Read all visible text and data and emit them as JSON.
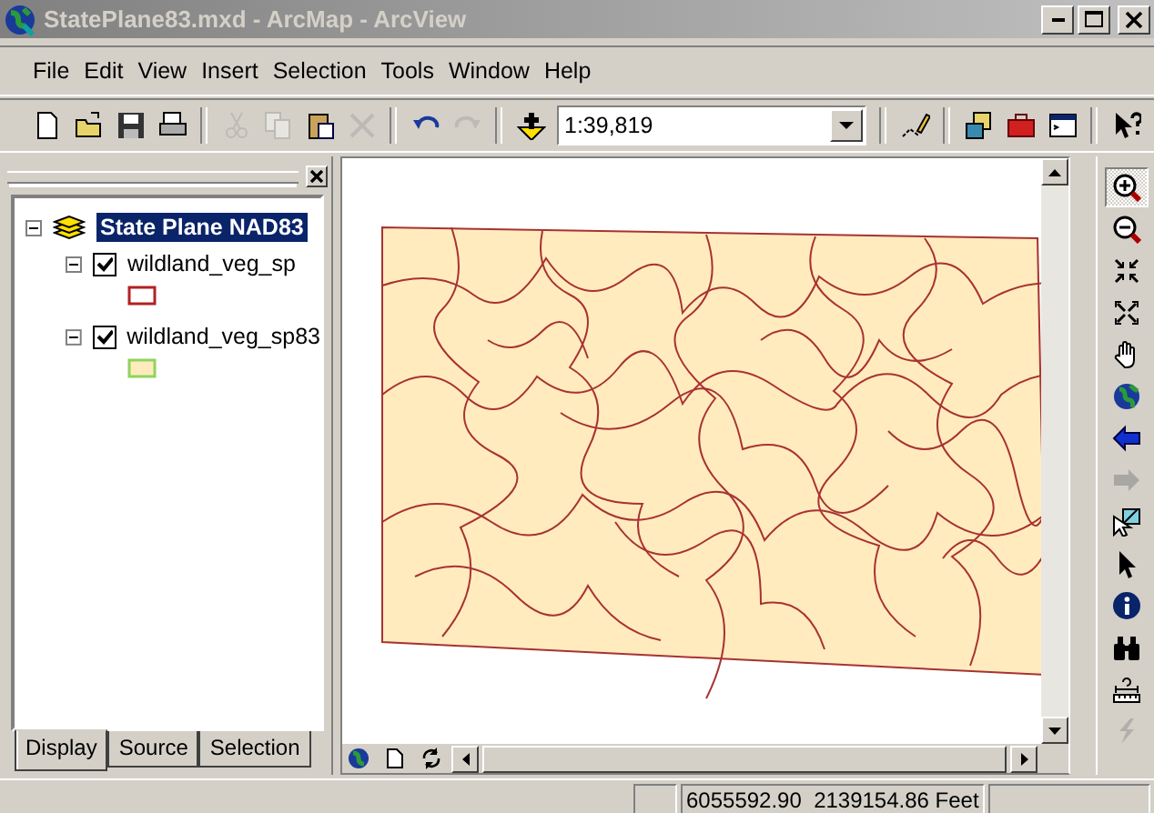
{
  "window": {
    "title": "StatePlane83.mxd - ArcMap - ArcView"
  },
  "menu": [
    {
      "label": "File"
    },
    {
      "label": "Edit"
    },
    {
      "label": "View"
    },
    {
      "label": "Insert"
    },
    {
      "label": "Selection"
    },
    {
      "label": "Tools"
    },
    {
      "label": "Window"
    },
    {
      "label": "Help"
    }
  ],
  "toolbar": [
    {
      "kind": "new",
      "disabled": false
    },
    {
      "kind": "open",
      "disabled": false
    },
    {
      "kind": "save",
      "disabled": false
    },
    {
      "kind": "print",
      "disabled": false
    },
    {
      "kind": "separator"
    },
    {
      "kind": "cut",
      "disabled": true
    },
    {
      "kind": "copy",
      "disabled": true
    },
    {
      "kind": "paste",
      "disabled": false
    },
    {
      "kind": "delete",
      "disabled": true
    },
    {
      "kind": "separator"
    },
    {
      "kind": "undo",
      "disabled": false
    },
    {
      "kind": "redo",
      "disabled": true
    },
    {
      "kind": "separator"
    },
    {
      "kind": "add-data",
      "disabled": false
    },
    {
      "kind": "scale",
      "value": "1:39,819"
    },
    {
      "kind": "separator"
    },
    {
      "kind": "editor",
      "disabled": false
    },
    {
      "kind": "separator"
    },
    {
      "kind": "catalog",
      "disabled": false
    },
    {
      "kind": "toolbox",
      "disabled": false
    },
    {
      "kind": "command",
      "disabled": false
    },
    {
      "kind": "separator"
    },
    {
      "kind": "help",
      "disabled": false
    }
  ],
  "toc": {
    "data_frame": {
      "label": "State Plane NAD83",
      "selected": true,
      "expanded": true
    },
    "layers": [
      {
        "name": "wildland_veg_sp",
        "checked": true,
        "expanded": true,
        "kind": "hollow",
        "color": "#b22222"
      },
      {
        "name": "wildland_veg_sp83",
        "checked": true,
        "expanded": true,
        "kind": "filled",
        "color": "#8fd45a"
      }
    ],
    "tabs": [
      {
        "label": "Display",
        "selected": true
      },
      {
        "label": "Source",
        "selected": false
      },
      {
        "label": "Selection",
        "selected": false
      }
    ]
  },
  "tools": [
    {
      "kind": "zoom-in",
      "selected": true,
      "disabled": false
    },
    {
      "kind": "zoom-out",
      "selected": false,
      "disabled": false
    },
    {
      "kind": "fixed-in",
      "selected": false,
      "disabled": false
    },
    {
      "kind": "fixed-out",
      "selected": false,
      "disabled": false
    },
    {
      "kind": "pan",
      "selected": false,
      "disabled": false
    },
    {
      "kind": "globe",
      "selected": false,
      "disabled": false
    },
    {
      "kind": "back",
      "selected": false,
      "disabled": false
    },
    {
      "kind": "forward",
      "selected": false,
      "disabled": true
    },
    {
      "kind": "select-features",
      "selected": false,
      "disabled": false
    },
    {
      "kind": "pointer",
      "selected": false,
      "disabled": false
    },
    {
      "kind": "identify",
      "selected": false,
      "disabled": false
    },
    {
      "kind": "find",
      "selected": false,
      "disabled": false
    },
    {
      "kind": "measure",
      "selected": false,
      "disabled": false
    },
    {
      "kind": "lightning",
      "selected": false,
      "disabled": true
    }
  ],
  "status_bar": {
    "coordinates": "6055592.90  2139154.86 Feet"
  }
}
